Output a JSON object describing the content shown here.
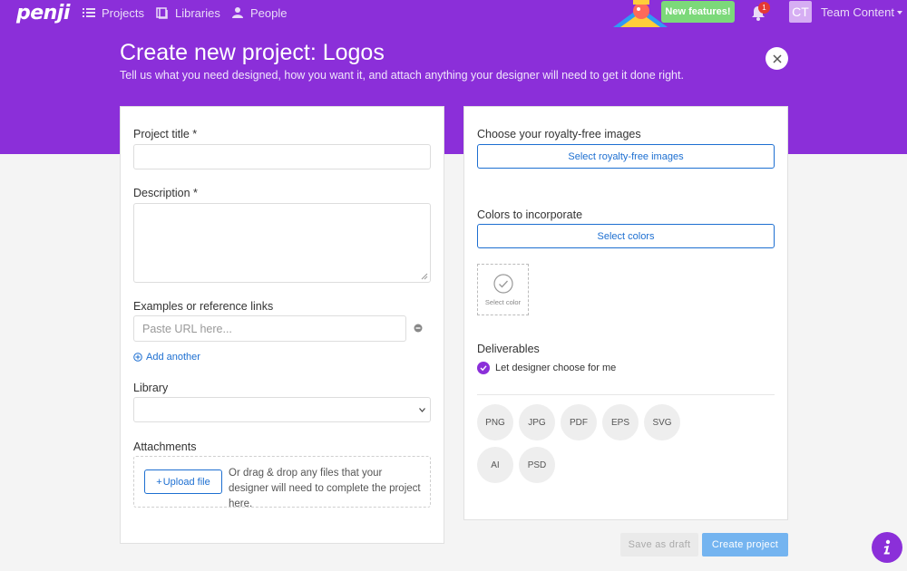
{
  "nav": {
    "logo": "penji",
    "items": [
      {
        "label": "Projects",
        "icon": "list-icon"
      },
      {
        "label": "Libraries",
        "icon": "library-icon"
      },
      {
        "label": "People",
        "icon": "people-icon"
      }
    ],
    "new_features": "New features!",
    "notifications_count": "1",
    "avatar_initials": "CT",
    "team_label": "Team Content"
  },
  "header": {
    "title": "Create new project: Logos",
    "subtitle": "Tell us what you need designed, how you want it, and attach anything your designer will need to get it done right."
  },
  "form": {
    "project_title_label": "Project title *",
    "project_title_value": "",
    "description_label": "Description *",
    "description_value": "",
    "examples_label": "Examples or reference links",
    "url_placeholder": "Paste URL here...",
    "add_another": "Add another",
    "library_label": "Library",
    "library_selected": "",
    "attachments_label": "Attachments",
    "upload_button": "Upload file",
    "upload_help": "Or drag & drop any files that your designer will need to complete the project here."
  },
  "options": {
    "images_label": "Choose your royalty-free images",
    "images_button": "Select royalty-free images",
    "colors_label": "Colors to incorporate",
    "colors_button": "Select colors",
    "select_color": "Select color",
    "deliverables_label": "Deliverables",
    "designer_choose": "Let designer choose for me",
    "formats": [
      "PNG",
      "JPG",
      "PDF",
      "EPS",
      "SVG",
      "AI",
      "PSD"
    ]
  },
  "actions": {
    "save_draft": "Save as draft",
    "create_project": "Create project"
  },
  "colors": {
    "brand_purple": "#8b2fd9",
    "link_blue": "#1d6fd1",
    "new_features_green": "#7cd97a",
    "create_button_blue": "#74b4f0"
  }
}
